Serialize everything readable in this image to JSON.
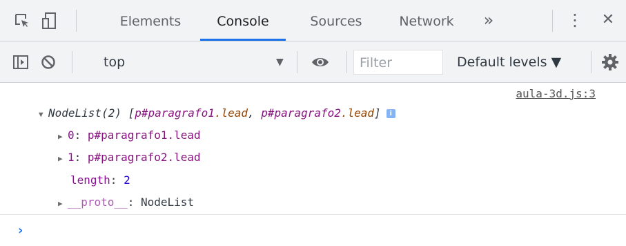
{
  "tabs": {
    "items": [
      {
        "label": "Elements"
      },
      {
        "label": "Console"
      },
      {
        "label": "Sources"
      },
      {
        "label": "Network"
      }
    ],
    "overflow": "»",
    "menu": "⋮",
    "close": "✕"
  },
  "toolbar": {
    "context": "top",
    "context_arrow": "▼",
    "filter_placeholder": "Filter",
    "levels": "Default levels ▼"
  },
  "console": {
    "source": "aula-3d.js:3",
    "nodelist": {
      "prefix": "NodeList(2) [",
      "item1_tag": "p#paragrafo1",
      "item1_cls": ".lead",
      "sep": ", ",
      "item2_tag": "p#paragrafo2",
      "item2_cls": ".lead",
      "suffix": "]",
      "info": "i"
    },
    "entries": [
      {
        "key": "0",
        "value": "p#paragrafo1.lead"
      },
      {
        "key": "1",
        "value": "p#paragrafo2.lead"
      }
    ],
    "length_key": "length",
    "length_value": "2",
    "proto_key": "__proto__",
    "proto_value": "NodeList",
    "prompt": "›"
  },
  "colors": {
    "accent": "#1a73e8",
    "toolbar_bg": "#f1f3f4"
  }
}
